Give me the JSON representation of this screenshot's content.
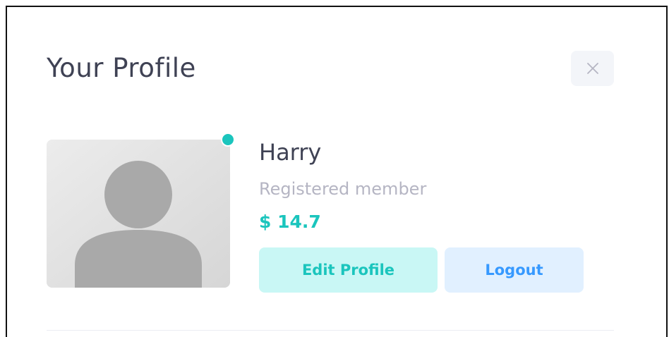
{
  "panel": {
    "title": "Your Profile",
    "close_icon": "close-icon"
  },
  "user": {
    "name": "Harry",
    "role": "Registered member",
    "balance": "$ 14.7",
    "status": "online",
    "avatar_icon": "user-placeholder-icon"
  },
  "actions": {
    "edit_label": "Edit Profile",
    "logout_label": "Logout"
  },
  "colors": {
    "title_text": "#3f4254",
    "muted_text": "#b5b5c3",
    "success": "#1bc5bd",
    "success_light": "#c9f7f5",
    "primary": "#3699ff",
    "primary_light": "#e1f0ff",
    "close_button_bg": "#f3f5f9",
    "online_dot": "#1bc5bd"
  }
}
